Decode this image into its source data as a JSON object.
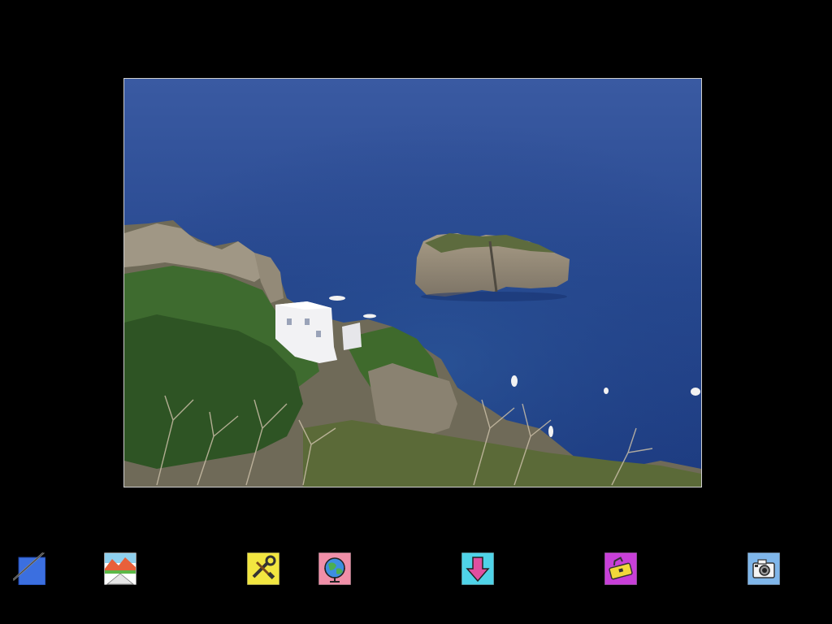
{
  "photo": {
    "subject": "coastal-cliffs-with-rock-islet",
    "colors": {
      "sea_top": "#2f4f98",
      "sea_bottom": "#1e3f86",
      "frame_border": "#cfcfcf"
    }
  },
  "toolbar": {
    "items": [
      {
        "icon": "pencil-notepad-icon",
        "color": "#3b6fe0"
      },
      {
        "icon": "landscape-mountains-icon",
        "color": "#8fd0ee"
      },
      {
        "icon": "tools-wrench-screwdriver-icon",
        "color": "#f2e640"
      },
      {
        "icon": "globe-icon",
        "color": "#f08fa8"
      },
      {
        "icon": "down-arrow-icon",
        "color": "#4fd3e8"
      },
      {
        "icon": "toolbox-icon",
        "color": "#c83fd8"
      },
      {
        "icon": "camera-icon",
        "color": "#7fb6ea"
      }
    ]
  },
  "colors": {
    "background": "#000000",
    "accent_blue": "#3b6fe0"
  }
}
